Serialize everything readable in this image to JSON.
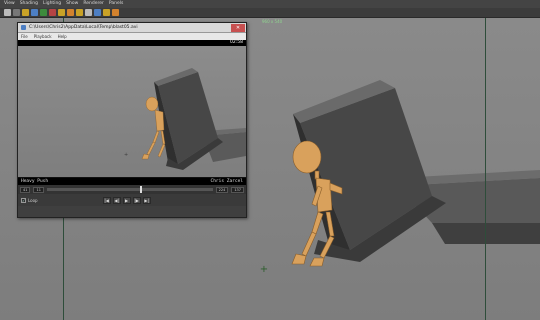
{
  "menubar": {
    "items": [
      "View",
      "Shading",
      "Lighting",
      "Show",
      "Renderer",
      "Panels"
    ]
  },
  "viewport": {
    "resolution_label": "960 x 540"
  },
  "playblast": {
    "title": "C:\\Users\\Chris2\\AppData\\Local\\Temp\\blast05.avi",
    "close_label": "✕",
    "menu": [
      "File",
      "Playback",
      "Help"
    ],
    "timecode": "02:58",
    "caption_left": "Heavy Push",
    "caption_right": "Chris Zarcel",
    "start_field": "41",
    "end_field": "11",
    "current_frame": "224",
    "total_frames": "137",
    "loop_label": "Loop",
    "loop_checked": true,
    "progress": 0.56,
    "transport": [
      "|◀",
      "◀|",
      "▶",
      "|▶",
      "▶|"
    ]
  },
  "colors": {
    "accent": "#2e4d3a",
    "character": "#d9a15c",
    "box_top": "#727272",
    "box_side": "#4f4f4f",
    "box_front": "#3b3b3b"
  },
  "icons": [
    "select-icon",
    "lasso-icon",
    "paint-icon",
    "move-icon",
    "rotate-icon",
    "scale-icon",
    "snap-grid-icon",
    "snap-curve-icon",
    "snap-point-icon",
    "render-icon",
    "ipr-icon",
    "render-settings-icon",
    "hypershade-icon"
  ]
}
